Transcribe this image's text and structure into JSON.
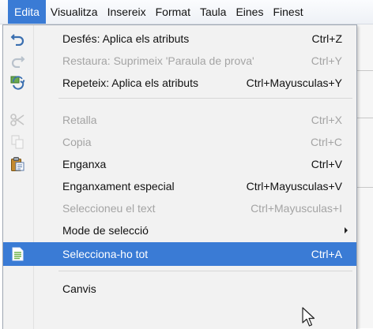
{
  "menubar": {
    "items": [
      {
        "label": "Edita",
        "active": true
      },
      {
        "label": "Visualitza"
      },
      {
        "label": "Insereix"
      },
      {
        "label": "Format"
      },
      {
        "label": "Taula"
      },
      {
        "label": "Eines"
      },
      {
        "label": "Finest"
      }
    ]
  },
  "menu": {
    "items": [
      {
        "label": "Desfés: Aplica els atributs",
        "shortcut": "Ctrl+Z",
        "icon": "undo-icon",
        "enabled": true
      },
      {
        "label": "Restaura: Suprimeix 'Paraula de prova'",
        "shortcut": "Ctrl+Y",
        "icon": "redo-icon",
        "enabled": false
      },
      {
        "label": "Repeteix: Aplica els atributs",
        "shortcut": "Ctrl+Mayusculas+Y",
        "icon": "repeat-icon",
        "enabled": true
      },
      {
        "label": "Retalla",
        "shortcut": "Ctrl+X",
        "icon": "scissors-icon",
        "enabled": false
      },
      {
        "label": "Copia",
        "shortcut": "Ctrl+C",
        "icon": "copy-icon",
        "enabled": false
      },
      {
        "label": "Enganxa",
        "shortcut": "Ctrl+V",
        "icon": "paste-icon",
        "enabled": true
      },
      {
        "label": "Enganxament especial",
        "shortcut": "Ctrl+Mayusculas+V",
        "enabled": true
      },
      {
        "label": "Seleccioneu el text",
        "shortcut": "Ctrl+Mayusculas+I",
        "enabled": false
      },
      {
        "label": "Mode de selecció",
        "submenu": true,
        "enabled": true
      },
      {
        "label": "Selecciona-ho tot",
        "shortcut": "Ctrl+A",
        "icon": "select-all-icon",
        "enabled": true,
        "highlighted": true
      },
      {
        "label": "Canvis",
        "enabled": true
      }
    ]
  },
  "colors": {
    "highlight": "#3a7bd5",
    "disabled_text": "#a4a4a4",
    "menu_background": "#f2f2f2"
  }
}
